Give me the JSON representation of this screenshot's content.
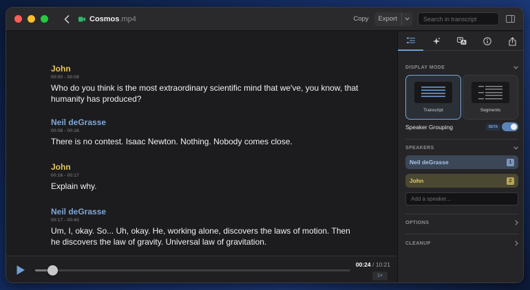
{
  "titlebar": {
    "file_name": "Cosmos",
    "file_ext": ".mp4",
    "copy_label": "Copy",
    "export_label": "Export",
    "search_placeholder": "Search in transcript"
  },
  "transcript": [
    {
      "speaker": "John",
      "time": "00:00 - 00:08",
      "text": "Who do you think is the most extraordinary scientific mind that we've, you know, that humanity has produced?"
    },
    {
      "speaker": "Neil deGrasse",
      "time": "00:08 - 00:16",
      "text": "There is no contest. Isaac Newton. Nothing. Nobody comes close."
    },
    {
      "speaker": "John",
      "time": "00:16 - 00:17",
      "text": "Explain why."
    },
    {
      "speaker": "Neil deGrasse",
      "time": "00:17 - 00:45",
      "text": "Um, I, okay. So... Uh, okay. He, working alone, discovers the laws of motion. Then he discovers the law of gravity. Universal law of gravitation."
    }
  ],
  "player": {
    "current_time": "00:24",
    "total_time": "10:21",
    "speed": "1×",
    "progress": 0.04
  },
  "panel": {
    "display_mode_title": "DISPLAY MODE",
    "modes": [
      "Transcript",
      "Segments"
    ],
    "speaker_grouping_label": "Speaker Grouping",
    "beta_badge": "BETA",
    "speakers_title": "SPEAKERS",
    "speakers": [
      {
        "name": "Neil deGrasse",
        "number": "1"
      },
      {
        "name": "John",
        "number": "2"
      }
    ],
    "add_speaker_placeholder": "Add a speaker...",
    "options_title": "OPTIONS",
    "cleanup_title": "CLEANUP"
  },
  "colors": {
    "john": "#e6c55a",
    "neil": "#7fa6d6",
    "accent": "#6f9fd8"
  },
  "icons": [
    "back-chevron-icon",
    "video-file-icon",
    "chevron-down-icon",
    "sidebar-toggle-icon",
    "list-icon",
    "sparkle-icon",
    "translate-icon",
    "info-icon",
    "share-icon",
    "play-icon",
    "chevron-right-icon"
  ]
}
